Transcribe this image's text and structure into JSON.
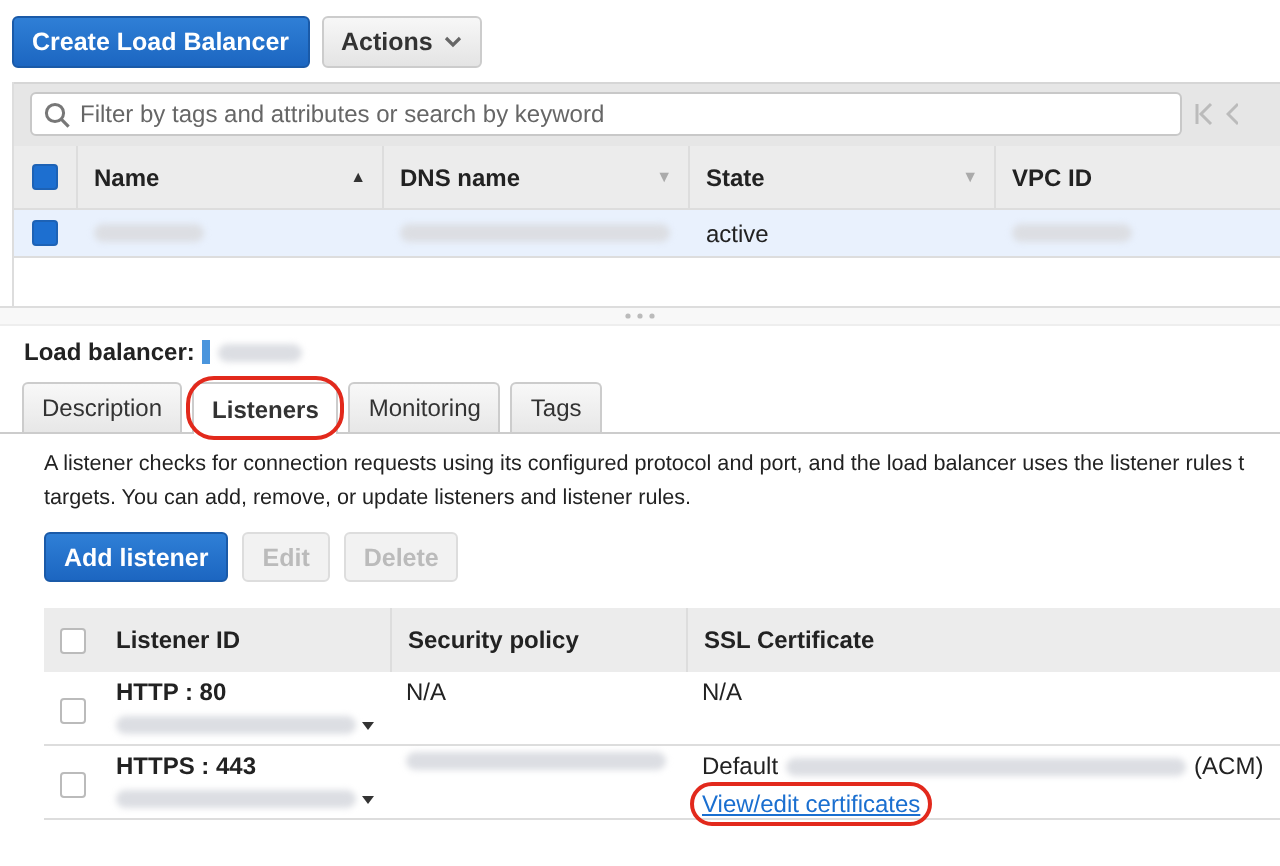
{
  "toolbar": {
    "create_button": "Create Load Balancer",
    "actions_button": "Actions"
  },
  "filter": {
    "placeholder": "Filter by tags and attributes or search by keyword"
  },
  "lb_table": {
    "all_checked": true,
    "columns": [
      {
        "label": "Name",
        "sort_icon": "▲"
      },
      {
        "label": "DNS name",
        "sort_icon": "▼"
      },
      {
        "label": "State",
        "sort_icon": "▼"
      },
      {
        "label": "VPC ID"
      }
    ],
    "rows": [
      {
        "selected": true,
        "checked": true,
        "state": "active"
      }
    ]
  },
  "details": {
    "label": "Load balancer:",
    "tabs": [
      {
        "label": "Description",
        "selected": false,
        "highlighted": false
      },
      {
        "label": "Listeners",
        "selected": true,
        "highlighted": true
      },
      {
        "label": "Monitoring",
        "selected": false,
        "highlighted": false
      },
      {
        "label": "Tags",
        "selected": false,
        "highlighted": false
      }
    ],
    "description": "A listener checks for connection requests using its configured protocol and port, and the load balancer uses the listener rules t\ntargets. You can add, remove, or update listeners and listener rules.",
    "buttons": [
      {
        "label": "Add listener",
        "disabled": false,
        "kind": "primary"
      },
      {
        "label": "Edit",
        "disabled": true,
        "kind": "default"
      },
      {
        "label": "Delete",
        "disabled": true,
        "kind": "default"
      }
    ],
    "listener_table": {
      "all_checked": false,
      "columns": [
        "Listener ID",
        "Security policy",
        "SSL Certificate"
      ],
      "rows": [
        {
          "checked": false,
          "listener_id": "HTTP : 80",
          "policy": "N/A",
          "certificate": "N/A"
        },
        {
          "checked": false,
          "listener_id": "HTTPS : 443",
          "certificate": "Default",
          "certificate_suffix": "(ACM)",
          "link": "View/edit certificates",
          "link_highlighted": true
        }
      ]
    }
  }
}
